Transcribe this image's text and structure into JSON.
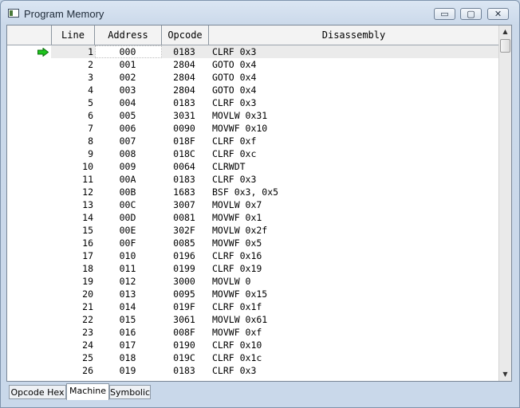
{
  "window": {
    "title": "Program Memory",
    "icon": "program-memory-window-icon",
    "controls": {
      "minimize": "▭",
      "maximize": "▢",
      "close": "✕"
    }
  },
  "table": {
    "columns": [
      "Line",
      "Address",
      "Opcode",
      "Disassembly"
    ],
    "current_line_indicator": "green-arrow-icon",
    "rows": [
      {
        "line": "1",
        "address": "000",
        "opcode": "0183",
        "disassembly": "CLRF 0x3"
      },
      {
        "line": "2",
        "address": "001",
        "opcode": "2804",
        "disassembly": "GOTO 0x4"
      },
      {
        "line": "3",
        "address": "002",
        "opcode": "2804",
        "disassembly": "GOTO 0x4"
      },
      {
        "line": "4",
        "address": "003",
        "opcode": "2804",
        "disassembly": "GOTO 0x4"
      },
      {
        "line": "5",
        "address": "004",
        "opcode": "0183",
        "disassembly": "CLRF 0x3"
      },
      {
        "line": "6",
        "address": "005",
        "opcode": "3031",
        "disassembly": "MOVLW 0x31"
      },
      {
        "line": "7",
        "address": "006",
        "opcode": "0090",
        "disassembly": "MOVWF 0x10"
      },
      {
        "line": "8",
        "address": "007",
        "opcode": "018F",
        "disassembly": "CLRF 0xf"
      },
      {
        "line": "9",
        "address": "008",
        "opcode": "018C",
        "disassembly": "CLRF 0xc"
      },
      {
        "line": "10",
        "address": "009",
        "opcode": "0064",
        "disassembly": "CLRWDT"
      },
      {
        "line": "11",
        "address": "00A",
        "opcode": "0183",
        "disassembly": "CLRF 0x3"
      },
      {
        "line": "12",
        "address": "00B",
        "opcode": "1683",
        "disassembly": "BSF 0x3, 0x5"
      },
      {
        "line": "13",
        "address": "00C",
        "opcode": "3007",
        "disassembly": "MOVLW 0x7"
      },
      {
        "line": "14",
        "address": "00D",
        "opcode": "0081",
        "disassembly": "MOVWF 0x1"
      },
      {
        "line": "15",
        "address": "00E",
        "opcode": "302F",
        "disassembly": "MOVLW 0x2f"
      },
      {
        "line": "16",
        "address": "00F",
        "opcode": "0085",
        "disassembly": "MOVWF 0x5"
      },
      {
        "line": "17",
        "address": "010",
        "opcode": "0196",
        "disassembly": "CLRF 0x16"
      },
      {
        "line": "18",
        "address": "011",
        "opcode": "0199",
        "disassembly": "CLRF 0x19"
      },
      {
        "line": "19",
        "address": "012",
        "opcode": "3000",
        "disassembly": "MOVLW 0"
      },
      {
        "line": "20",
        "address": "013",
        "opcode": "0095",
        "disassembly": "MOVWF 0x15"
      },
      {
        "line": "21",
        "address": "014",
        "opcode": "019F",
        "disassembly": "CLRF 0x1f"
      },
      {
        "line": "22",
        "address": "015",
        "opcode": "3061",
        "disassembly": "MOVLW 0x61"
      },
      {
        "line": "23",
        "address": "016",
        "opcode": "008F",
        "disassembly": "MOVWF 0xf"
      },
      {
        "line": "24",
        "address": "017",
        "opcode": "0190",
        "disassembly": "CLRF 0x10"
      },
      {
        "line": "25",
        "address": "018",
        "opcode": "019C",
        "disassembly": "CLRF 0x1c"
      },
      {
        "line": "26",
        "address": "019",
        "opcode": "0183",
        "disassembly": "CLRF 0x3"
      }
    ]
  },
  "scrollbar": {
    "up": "▲",
    "down": "▼"
  },
  "tabs": [
    {
      "label": "Opcode Hex",
      "active": false
    },
    {
      "label": "Machine",
      "active": true
    },
    {
      "label": "Symbolic",
      "active": false
    }
  ],
  "colors": {
    "arrow": "#1fc41f",
    "selected_row": "#ebebeb"
  }
}
